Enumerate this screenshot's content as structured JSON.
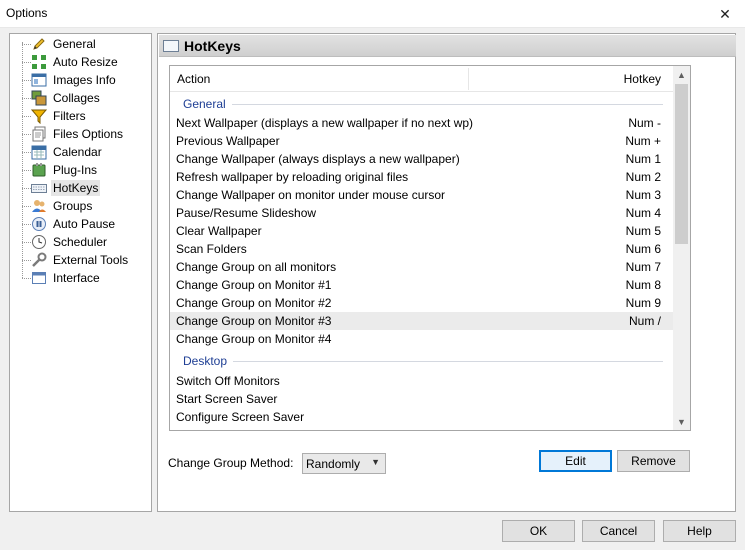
{
  "window": {
    "title": "Options",
    "close_glyph": "✕"
  },
  "tree": {
    "items": [
      {
        "label": "General",
        "icon": "pencil-icon"
      },
      {
        "label": "Auto Resize",
        "icon": "resize-icon"
      },
      {
        "label": "Images Info",
        "icon": "info-icon"
      },
      {
        "label": "Collages",
        "icon": "collage-icon"
      },
      {
        "label": "Filters",
        "icon": "filter-icon"
      },
      {
        "label": "Files Options",
        "icon": "files-icon"
      },
      {
        "label": "Calendar",
        "icon": "calendar-icon"
      },
      {
        "label": "Plug-Ins",
        "icon": "plugin-icon"
      },
      {
        "label": "HotKeys",
        "icon": "keyboard-icon"
      },
      {
        "label": "Groups",
        "icon": "groups-icon"
      },
      {
        "label": "Auto Pause",
        "icon": "pause-icon"
      },
      {
        "label": "Scheduler",
        "icon": "clock-icon"
      },
      {
        "label": "External Tools",
        "icon": "wrench-icon"
      },
      {
        "label": "Interface",
        "icon": "interface-icon"
      }
    ],
    "selected": "HotKeys"
  },
  "panel": {
    "title": "HotKeys",
    "icon": "keyboard-icon"
  },
  "list": {
    "columns": {
      "action": "Action",
      "hotkey": "Hotkey"
    },
    "groups": [
      {
        "name": "General",
        "rows": [
          {
            "action": "Next Wallpaper (displays a new wallpaper if no next wp)",
            "hotkey": "Num -"
          },
          {
            "action": "Previous Wallpaper",
            "hotkey": "Num +"
          },
          {
            "action": "Change Wallpaper (always displays a new wallpaper)",
            "hotkey": "Num 1"
          },
          {
            "action": "Refresh wallpaper by reloading original files",
            "hotkey": "Num 2"
          },
          {
            "action": "Change Wallpaper on monitor under mouse cursor",
            "hotkey": "Num 3"
          },
          {
            "action": "Pause/Resume Slideshow",
            "hotkey": "Num 4"
          },
          {
            "action": "Clear Wallpaper",
            "hotkey": "Num 5"
          },
          {
            "action": "Scan Folders",
            "hotkey": "Num 6"
          },
          {
            "action": "Change Group on all monitors",
            "hotkey": "Num 7"
          },
          {
            "action": "Change Group on Monitor #1",
            "hotkey": "Num 8"
          },
          {
            "action": "Change Group on Monitor #2",
            "hotkey": "Num 9"
          },
          {
            "action": "Change Group on Monitor #3",
            "hotkey": "Num /"
          },
          {
            "action": "Change Group on Monitor #4",
            "hotkey": ""
          }
        ]
      },
      {
        "name": "Desktop",
        "rows": [
          {
            "action": "Switch Off Monitors",
            "hotkey": ""
          },
          {
            "action": "Start Screen Saver",
            "hotkey": ""
          },
          {
            "action": "Configure Screen Saver",
            "hotkey": ""
          }
        ]
      }
    ],
    "highlighted_action": "Change Group on Monitor #3"
  },
  "change_group_method": {
    "label": "Change Group Method:",
    "value": "Randomly"
  },
  "buttons": {
    "edit": "Edit",
    "remove": "Remove",
    "ok": "OK",
    "cancel": "Cancel",
    "help": "Help"
  }
}
